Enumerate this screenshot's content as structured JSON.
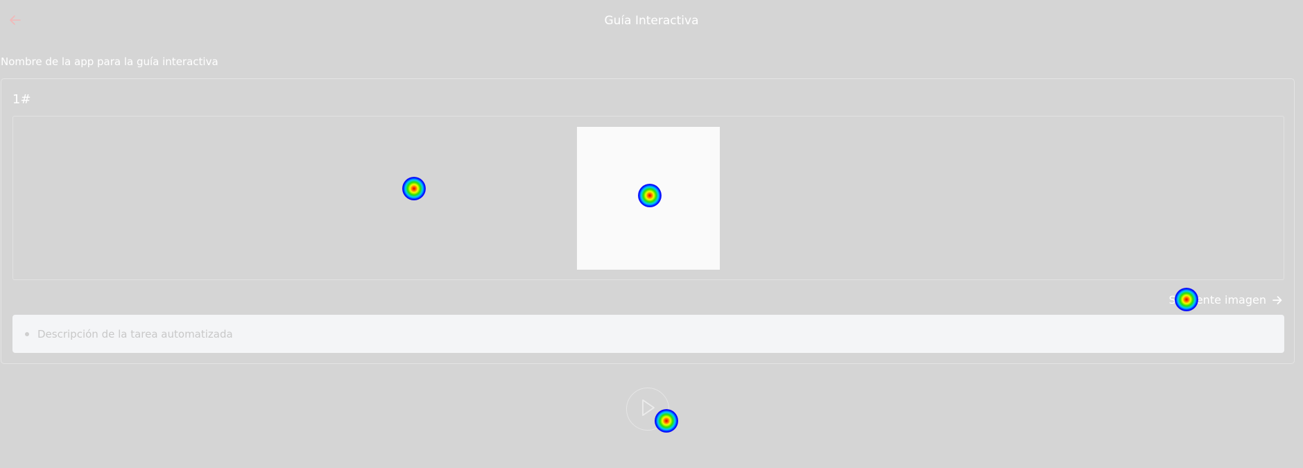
{
  "header": {
    "title": "Guía Interactiva",
    "back_icon": "arrow-left-icon",
    "accent_color": "#f2b8b8"
  },
  "form": {
    "app_name_label": "Nombre de la app para la guía interactiva",
    "step": {
      "number_label": "1#",
      "next_image_label": "Siguiente imagen",
      "description_placeholder": "Descripción de la tarea automatizada"
    }
  },
  "actions": {
    "play_icon": "play-icon"
  }
}
